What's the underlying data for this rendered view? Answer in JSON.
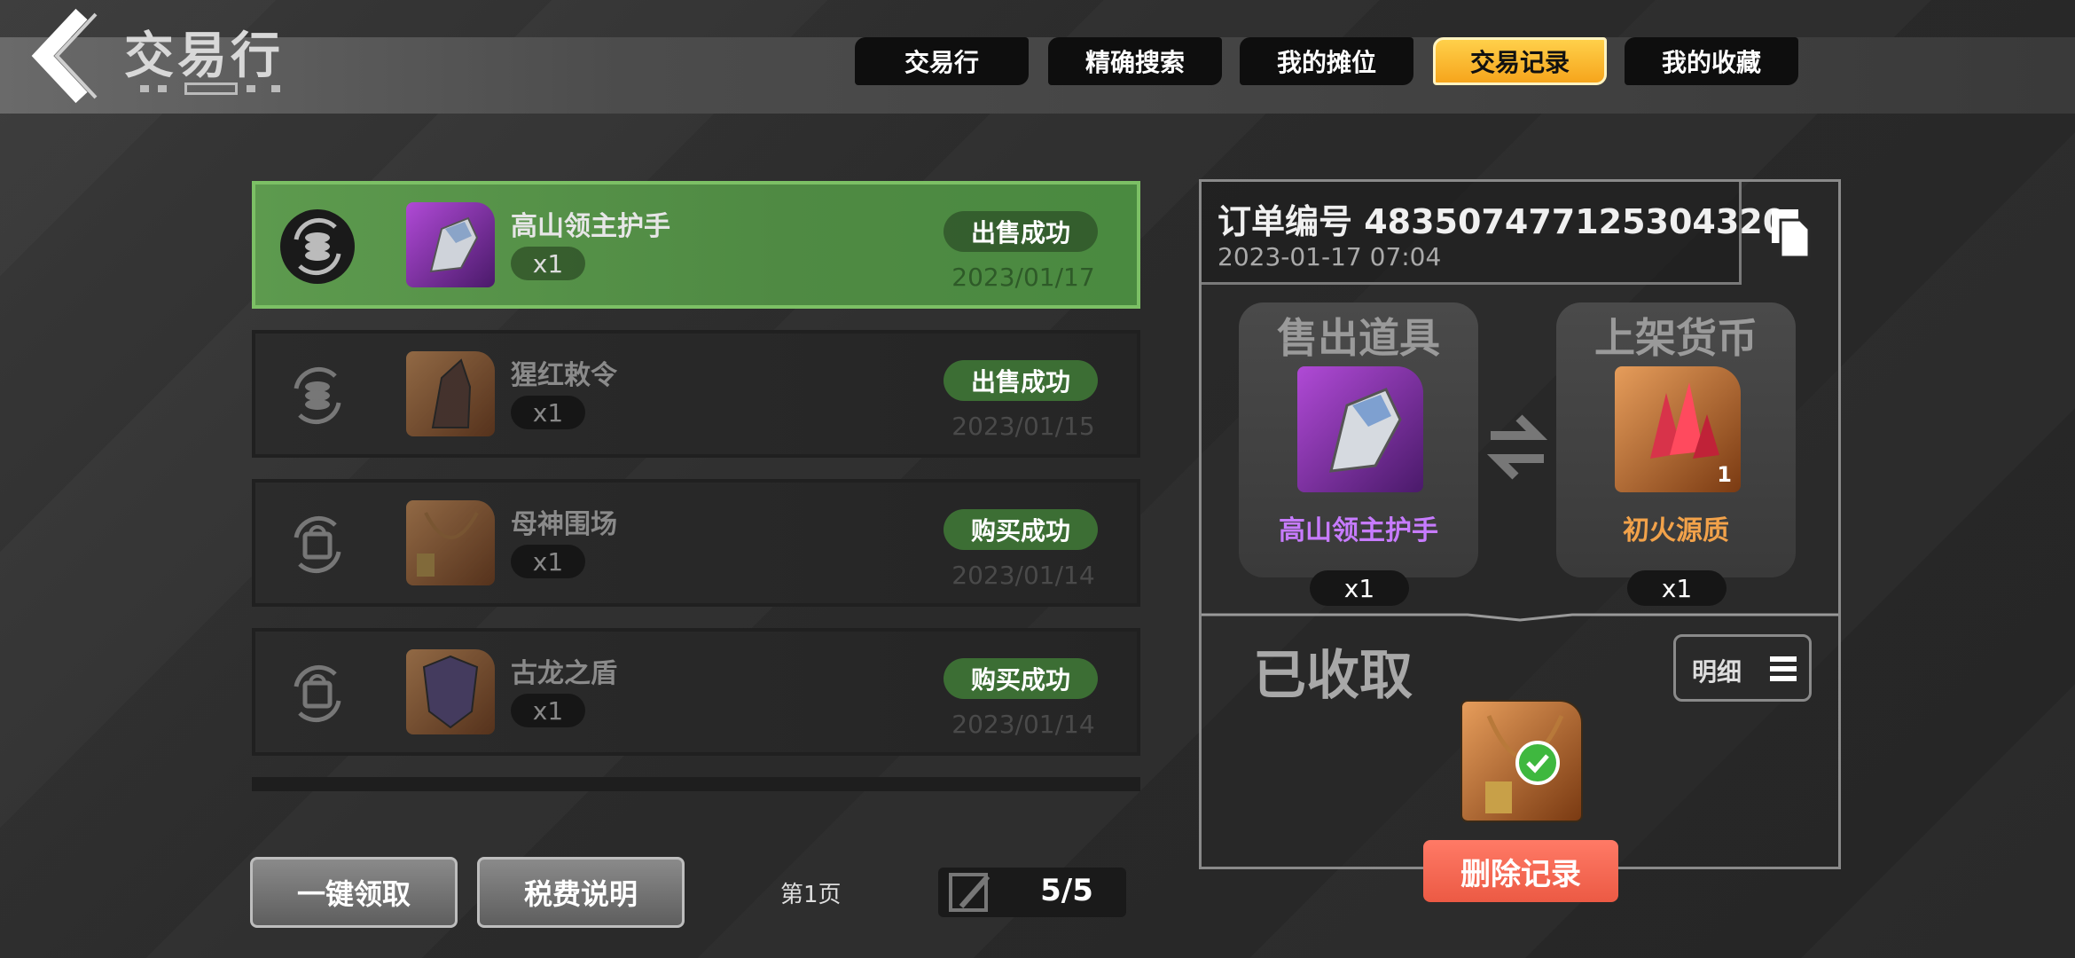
{
  "header": {
    "title": "交易行",
    "back_icon": "chevron-left-icon"
  },
  "tabs": [
    {
      "label": "交易行",
      "active": false
    },
    {
      "label": "精确搜索",
      "active": false
    },
    {
      "label": "我的摊位",
      "active": false
    },
    {
      "label": "交易记录",
      "active": true
    },
    {
      "label": "我的收藏",
      "active": false
    }
  ],
  "records": [
    {
      "type_icon": "coin-exchange-icon",
      "item": "高山领主护手",
      "qty": "x1",
      "status": "出售成功",
      "date": "2023/01/17",
      "selected": true,
      "thumb_color": "purple"
    },
    {
      "type_icon": "coin-exchange-icon",
      "item": "猩红敕令",
      "qty": "x1",
      "status": "出售成功",
      "date": "2023/01/15",
      "selected": false,
      "thumb_color": "orange"
    },
    {
      "type_icon": "purchase-exchange-icon",
      "item": "母神围场",
      "qty": "x1",
      "status": "购买成功",
      "date": "2023/01/14",
      "selected": false,
      "thumb_color": "orange"
    },
    {
      "type_icon": "purchase-exchange-icon",
      "item": "古龙之盾",
      "qty": "x1",
      "status": "购买成功",
      "date": "2023/01/14",
      "selected": false,
      "thumb_color": "orange"
    }
  ],
  "bottom": {
    "claim_all": "一键领取",
    "tax_info": "税费说明",
    "page_label": "第1页",
    "page_count": "5/5"
  },
  "detail": {
    "order_label": "订单编号 483507477125304320",
    "order_time": "2023-01-17 07:04",
    "sold_title": "售出道具",
    "sold_name": "高山领主护手",
    "sold_qty": "x1",
    "currency_title": "上架货币",
    "currency_name": "初火源质",
    "currency_qty": "x1",
    "currency_stack": "1",
    "collected": "已收取",
    "detail_btn": "明细",
    "delete_btn": "删除记录"
  },
  "colors": {
    "accent_tab": "#f6a51c",
    "selected_row": "#5d9a4e",
    "status_pill": "#3c6e34",
    "sold_name": "#c77bff",
    "currency_name": "#f2a24a",
    "delete": "#ec5a44"
  }
}
